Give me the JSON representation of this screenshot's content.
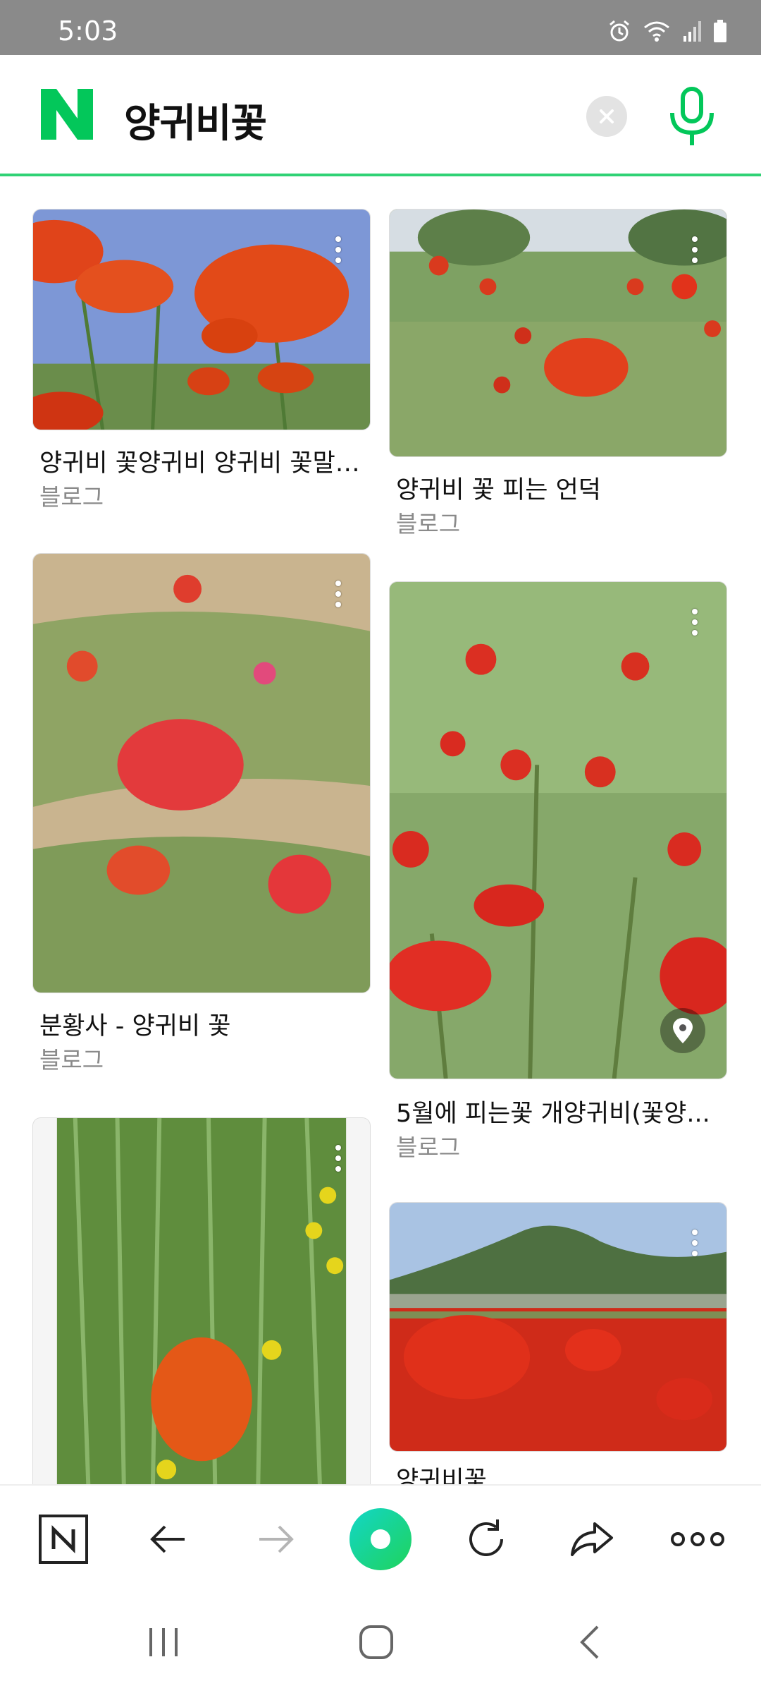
{
  "status": {
    "time": "5:03",
    "icons": [
      "alarm-icon",
      "wifi-icon",
      "signal-icon",
      "battery-icon"
    ]
  },
  "search": {
    "logo_letter": "N",
    "query": "양귀비꽃",
    "clear_icon": "close-icon",
    "mic_icon": "mic-icon"
  },
  "results": [
    {
      "title": "양귀비 꽃양귀비 양귀비 꽃말 ...",
      "source": "블로그"
    },
    {
      "title": "양귀비 꽃 피는 언덕",
      "source": "블로그"
    },
    {
      "title": "분황사 - 양귀비 꽃",
      "source": "블로그"
    },
    {
      "title": "5월에 피는꽃 개양귀비(꽃양...",
      "source": "블로그"
    },
    {
      "title": "",
      "source": ""
    },
    {
      "title": "양귀비꽃",
      "source": ""
    }
  ],
  "toolbar": {
    "icons": [
      "naver-home-icon",
      "back-arrow-icon",
      "forward-arrow-icon",
      "green-dot-icon",
      "reload-icon",
      "share-icon",
      "more-icon"
    ]
  },
  "navbar": {
    "icons": [
      "recent-apps-icon",
      "home-icon",
      "back-icon"
    ]
  },
  "colors": {
    "brand_green": "#03c75a",
    "accent_line": "#2fd275"
  }
}
